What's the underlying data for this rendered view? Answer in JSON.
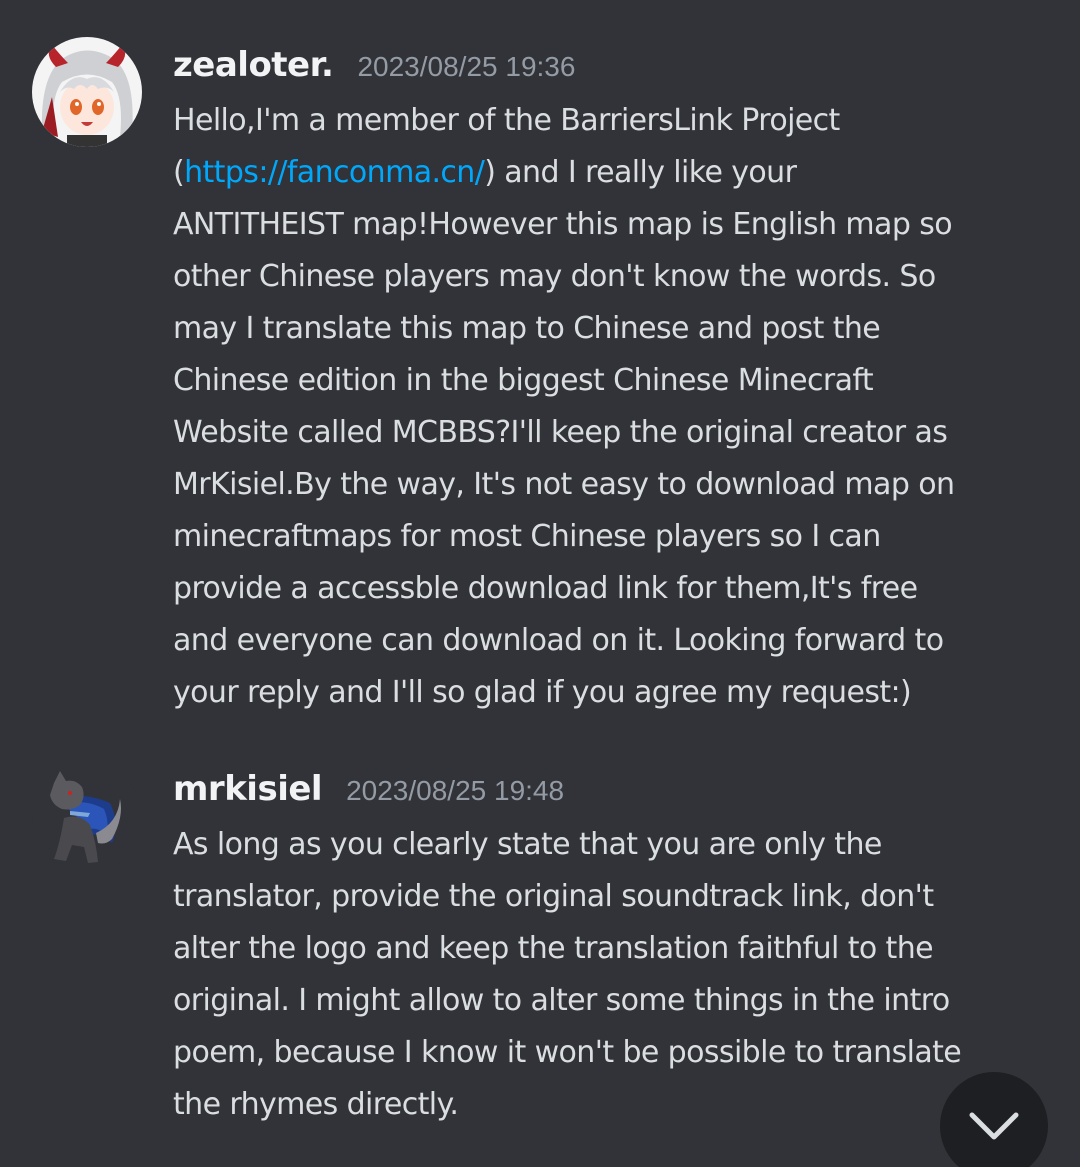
{
  "messages": [
    {
      "username": "zealoter.",
      "timestamp": "2023/08/25 19:36",
      "lines": {
        "l1": "Hello,I'm a member of the BarriersLink Project",
        "l2_open": "(",
        "l2_link": "https://fanconma.cn/",
        "l2_rest": ") and I really like your",
        "l3": "ANTITHEIST map!However this map is English map so",
        "l4": "other Chinese players may don't know the words. So",
        "l5": "may I translate this map to Chinese and post the",
        "l6": "Chinese edition in the biggest Chinese Minecraft",
        "l7": "Website called MCBBS?I'll keep the original creator as",
        "l8": "MrKisiel.By the way, It's not easy to download map on",
        "l9": "minecraftmaps for most Chinese players so I can",
        "l10": "provide a accessble download link for them,It's free",
        "l11": "and everyone can download on it. Looking forward to",
        "l12": "your reply and I'll so glad if you agree my request:)"
      },
      "avatar_icon": "anime-girl-avatar-icon"
    },
    {
      "username": "mrkisiel",
      "timestamp": "2023/08/25 19:48",
      "lines": {
        "l1": "As long as you clearly state that you are only the",
        "l2": "translator, provide the original soundtrack link, don't",
        "l3": "alter the logo and keep the translation faithful to the",
        "l4": "original. I might allow to alter some things in the intro",
        "l5": "poem, because I know it won't be possible to translate",
        "l6": "the rhymes directly."
      },
      "avatar_icon": "wolf-avatar-icon"
    }
  ],
  "scroll_button": {
    "icon": "chevron-down-icon"
  },
  "colors": {
    "background": "#313338",
    "username": "#f2f3f5",
    "timestamp": "#949ba4",
    "text": "#dbdee1",
    "link": "#00a8fc",
    "button": "#1e1f22"
  }
}
